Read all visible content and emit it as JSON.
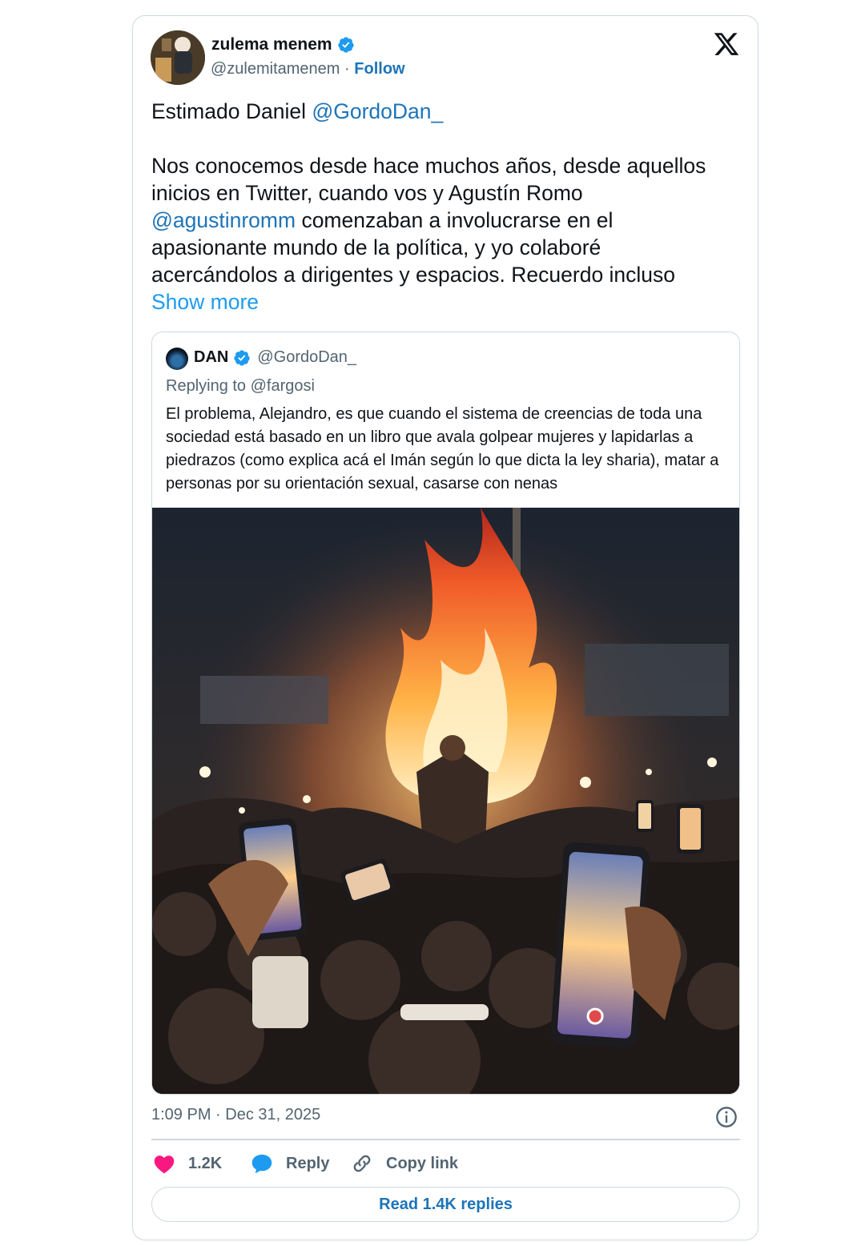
{
  "author": {
    "name": "zulema menem",
    "handle": "@zulemitamenem",
    "separator": "·",
    "follow_label": "Follow",
    "verified": true
  },
  "tweet": {
    "line1_text": "Estimado Daniel ",
    "line1_mention": "@GordoDan_",
    "para2_text_a": "Nos conocemos desde hace muchos años, desde aquellos inicios en Twitter, cuando vos y Agustín Romo ",
    "para2_mention": "@agustinromm",
    "para2_text_b": " comenzaban a involucrarse en el apasionante mundo de la política, y yo colaboré acercándolos a dirigentes y espacios. Recuerdo incluso ",
    "show_more": "Show more"
  },
  "quoted": {
    "name": "DAN",
    "handle": "@GordoDan_",
    "replying_to": "Replying to @fargosi",
    "text": "El problema, Alejandro, es que cuando el sistema de creencias de toda una sociedad está basado en un libro que avala golpear mujeres y lapidarlas a piedrazos (como explica acá el Imán según lo que dicta la ley sharia), matar a personas por su orientación sexual, casarse con nenas"
  },
  "meta": {
    "timestamp": "1:09 PM · Dec 31, 2025"
  },
  "actions": {
    "like_count": "1.2K",
    "reply_label": "Reply",
    "copy_link_label": "Copy link",
    "read_replies": "Read 1.4K replies"
  },
  "colors": {
    "link": "#1d74b8",
    "verified": "#1d9bf0",
    "like": "#f91880",
    "reply": "#1d9bf0"
  }
}
